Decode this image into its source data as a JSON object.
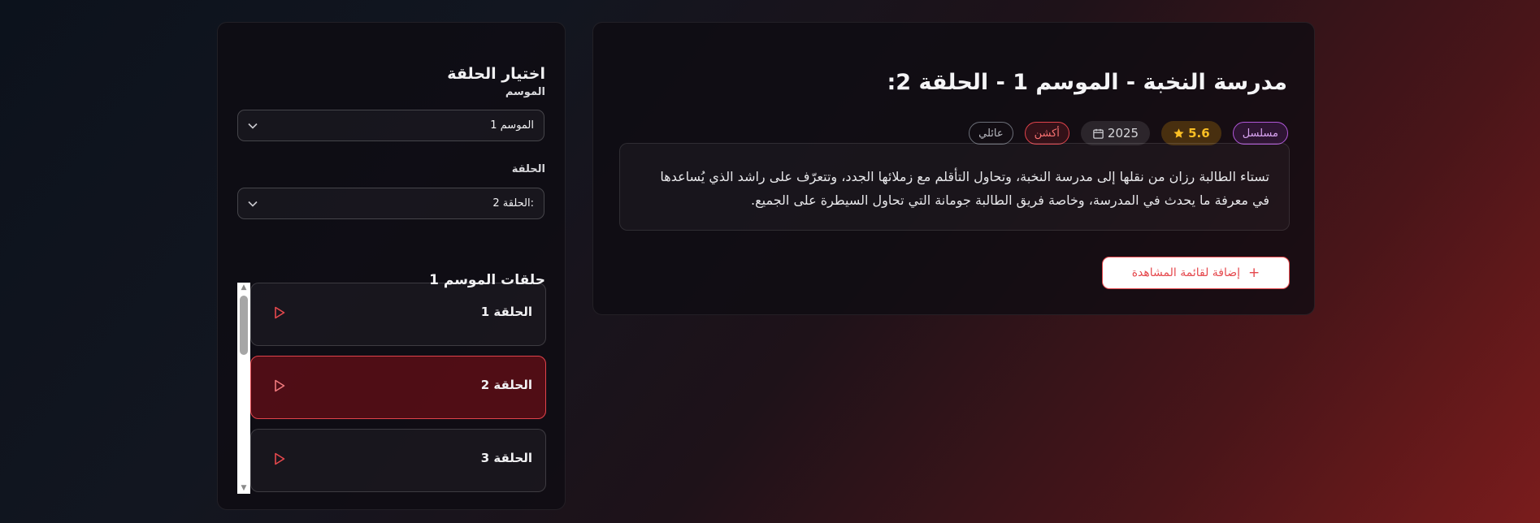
{
  "show": {
    "title": "مدرسة النخبة - الموسم 1 - الحلقة 2:",
    "badges": {
      "type": "مسلسل",
      "rating": "5.6",
      "year": "2025",
      "genres": [
        "أكشن",
        "عائلي"
      ]
    },
    "description": "تستاء الطالبة رزان من نقلها إلى مدرسة النخبة، وتحاول التأقلم مع زملائها الجدد، وتتعرّف على راشد الذي يُساعدها في معرفة ما يحدث في المدرسة، وخاصة فريق الطالبة جومانة التي تحاول السيطرة على الجميع.",
    "add_button_label": "إضافة لقائمة المشاهدة",
    "add_button_icon": "+"
  },
  "episode_picker": {
    "title": "اختيار الحلقة",
    "season_label": "الموسم",
    "season_value": "الموسم 1",
    "episode_label": "الحلقة",
    "episode_value": "الحلقة 2:",
    "list_heading": "حلقات الموسم 1",
    "episodes": [
      {
        "label": "الحلقة 1",
        "active": false
      },
      {
        "label": "الحلقة 2",
        "active": true
      },
      {
        "label": "الحلقة 3",
        "active": false
      }
    ]
  },
  "colors": {
    "accent": "#e5484d",
    "type_badge": "#b057d8",
    "rating": "#fbbf24"
  },
  "icons": {
    "rating": "star-icon",
    "year": "calendar-icon",
    "select": "chevron-down-icon",
    "episode": "play-icon",
    "add": "plus-icon"
  }
}
